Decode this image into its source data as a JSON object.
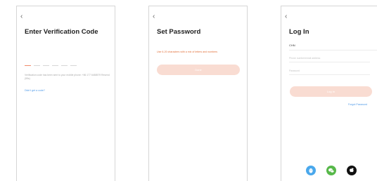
{
  "screens": {
    "verify": {
      "back_icon": "‹",
      "title": "Enter Verification Code",
      "code_slots": 6,
      "hint": "Verification code has been sent to your mobile phone: +86 177 6488579  Resend (55s)",
      "link": "Didn't get a code?"
    },
    "set_password": {
      "back_icon": "‹",
      "title": "Set Password",
      "error": "Use 6-20 characters with a mix of letters and numbers",
      "button": "Done"
    },
    "login": {
      "back_icon": "‹",
      "title": "Log In",
      "country": "CHN",
      "account_placeholder": "Phone number/email address",
      "password_placeholder": "Password",
      "button": "Log In",
      "forgot_link": "Forgot Password",
      "social_icons": [
        "tencent-qq-icon",
        "wechat-icon",
        "apple-icon"
      ]
    }
  },
  "colors": {
    "accent": "#f08a6a",
    "button_bg": "#f9dcd2",
    "link": "#4f9ae8",
    "error": "#e2703a",
    "qq": "#4aa8ec",
    "wechat": "#57b84a",
    "apple": "#111111"
  }
}
